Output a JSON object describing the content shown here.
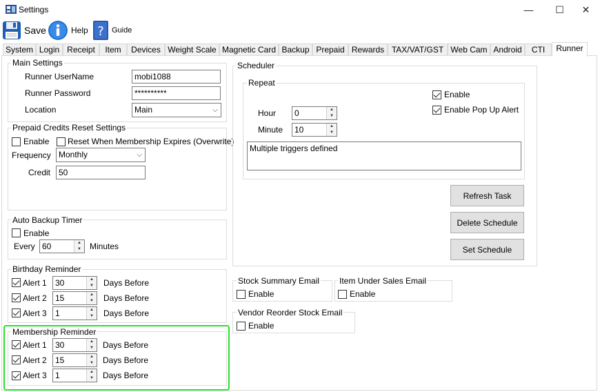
{
  "window": {
    "title": "Settings",
    "minimize": "—",
    "maximize": "☐",
    "close": "✕"
  },
  "toolbar": {
    "save_label": "Save",
    "help_label": "Help",
    "guide_label": "Guide"
  },
  "tabs": [
    "System",
    "Login",
    "Receipt",
    "Item",
    "Devices",
    "Weight Scale",
    "Magnetic Card",
    "Backup",
    "Prepaid",
    "Rewards",
    "TAX/VAT/GST",
    "Web Cam",
    "Android",
    "CTI",
    "Runner"
  ],
  "main_settings": {
    "title": "Main Settings",
    "username_label": "Runner UserName",
    "username_value": "mobi1088",
    "password_label": "Runner Password",
    "password_value": "**********",
    "location_label": "Location",
    "location_value": "Main"
  },
  "prepaid": {
    "title": "Prepaid Credits Reset Settings",
    "enable_label": "Enable",
    "enable_checked": false,
    "reset_label": "Reset When Membership Expires (Overwrite)",
    "reset_checked": false,
    "frequency_label": "Frequency",
    "frequency_value": "Monthly",
    "credit_label": "Credit",
    "credit_value": "50"
  },
  "auto_backup": {
    "title": "Auto Backup Timer",
    "enable_label": "Enable",
    "every_label": "Every",
    "every_value": "60",
    "minutes_label": "Minutes"
  },
  "birthday": {
    "title": "Birthday Reminder",
    "alerts": [
      {
        "label": "Alert 1",
        "value": "30",
        "suffix": "Days Before",
        "checked": true
      },
      {
        "label": "Alert 2",
        "value": "15",
        "suffix": "Days Before",
        "checked": true
      },
      {
        "label": "Alert 3",
        "value": "1",
        "suffix": "Days Before",
        "checked": true
      }
    ]
  },
  "membership": {
    "title": "Membership Reminder",
    "alerts": [
      {
        "label": "Alert 1",
        "value": "30",
        "suffix": "Days Before",
        "checked": true
      },
      {
        "label": "Alert 2",
        "value": "15",
        "suffix": "Days Before",
        "checked": true
      },
      {
        "label": "Alert 3",
        "value": "1",
        "suffix": "Days Before",
        "checked": true
      }
    ]
  },
  "scheduler": {
    "title": "Scheduler",
    "repeat_title": "Repeat",
    "enable_label": "Enable",
    "popup_label": "Enable Pop Up Alert",
    "hour_label": "Hour",
    "hour_value": "0",
    "minute_label": "Minute",
    "minute_value": "10",
    "triggers_text": "Multiple triggers defined",
    "refresh_label": "Refresh Task",
    "delete_label": "Delete Schedule",
    "set_label": "Set Schedule"
  },
  "stock_summary": {
    "title": "Stock Summary Email",
    "enable_label": "Enable"
  },
  "item_under_sales": {
    "title": "Item Under Sales Email",
    "enable_label": "Enable"
  },
  "vendor_reorder": {
    "title": "Vendor Reorder Stock Email",
    "enable_label": "Enable"
  },
  "colors": {
    "highlight": "#29e029",
    "save_icon": "#1e5fb4",
    "help_icon": "#1f6fd1"
  }
}
